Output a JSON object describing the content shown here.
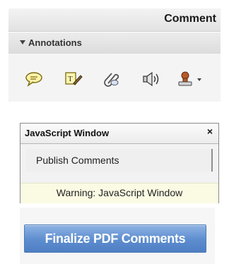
{
  "comment_pane": {
    "title": "Comment",
    "annotations_label": "Annotations",
    "tools": [
      {
        "name": "sticky-note-icon"
      },
      {
        "name": "highlight-text-icon"
      },
      {
        "name": "attach-file-icon"
      },
      {
        "name": "record-audio-icon"
      },
      {
        "name": "stamp-icon"
      }
    ]
  },
  "js_window": {
    "title": "JavaScript Window",
    "close_glyph": "×",
    "items": [
      "Publish Comments"
    ],
    "warning": "Warning: JavaScript Window"
  },
  "finalize": {
    "button_label": "Finalize PDF Comments"
  },
  "colors": {
    "accent_blue": "#5d8dcf",
    "warning_bg": "#fbfbe4"
  }
}
